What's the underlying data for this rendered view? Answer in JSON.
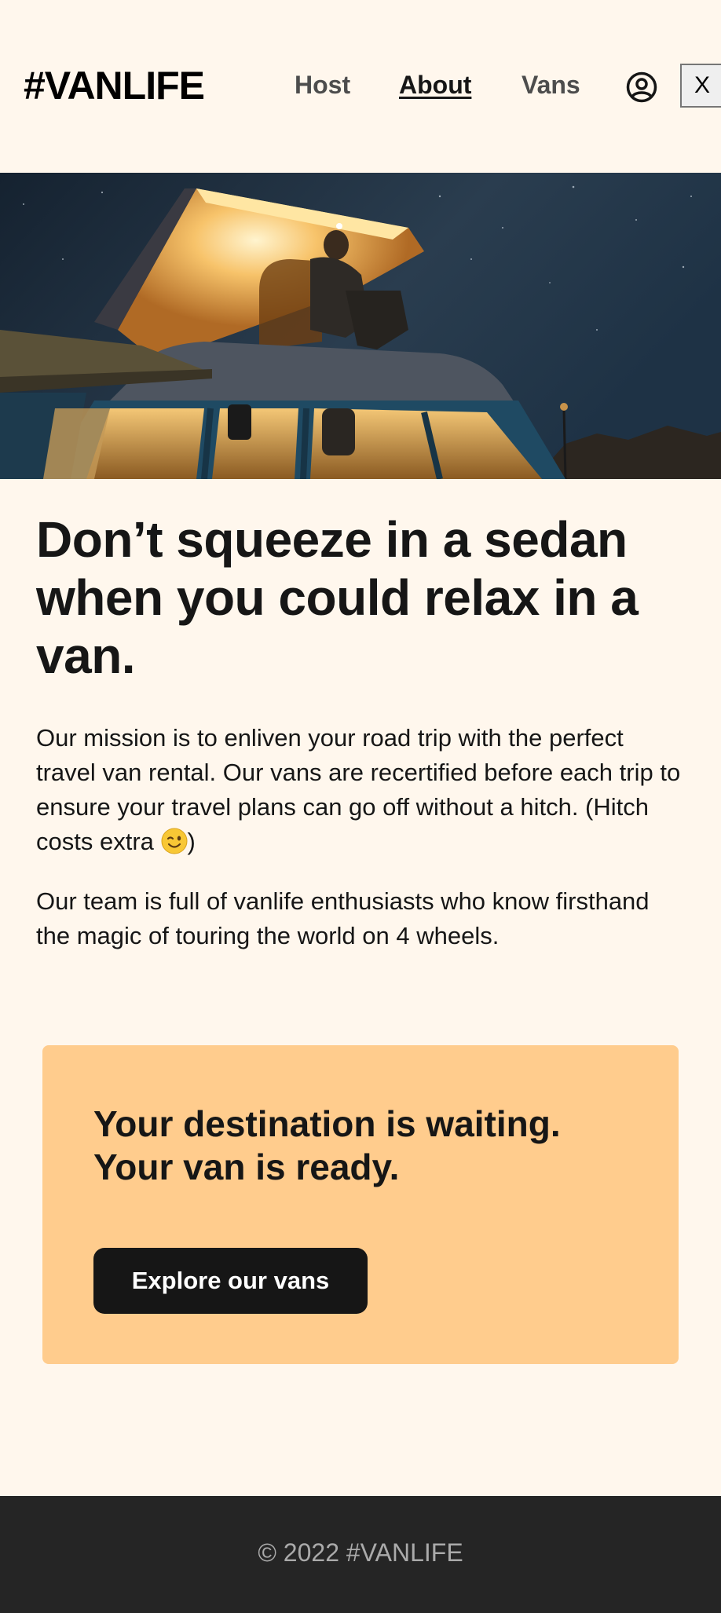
{
  "header": {
    "logo": "#VANLIFE",
    "nav": {
      "host": "Host",
      "about": "About",
      "vans": "Vans"
    },
    "user_icon": "user-circle-icon",
    "close_button": "X"
  },
  "hero": {
    "image": "camper-van-at-night-photo"
  },
  "main": {
    "headline": "Don’t squeeze in a sedan when you could relax in a van.",
    "paragraph1": "Our mission is to enliven your road trip with the perfect travel van rental. Our vans are recertified before each trip to ensure your travel plans can go off without a hitch. (Hitch costs extra ",
    "paragraph1_end": ")",
    "wink_icon": "winking-face-emoji",
    "paragraph2": "Our team is full of vanlife enthusiasts who know firsthand the magic of touring the world on 4 wheels."
  },
  "cta": {
    "title_line1": "Your destination is waiting.",
    "title_line2": "Your van is ready.",
    "button_label": "Explore our vans"
  },
  "footer": {
    "copyright": "© 2022 #VANLIFE"
  },
  "colors": {
    "page_background": "#FFF7ED",
    "cta_background": "#FFCC8D",
    "button_background": "#161616",
    "footer_background": "#252525",
    "footer_text": "#AAAAAA"
  }
}
